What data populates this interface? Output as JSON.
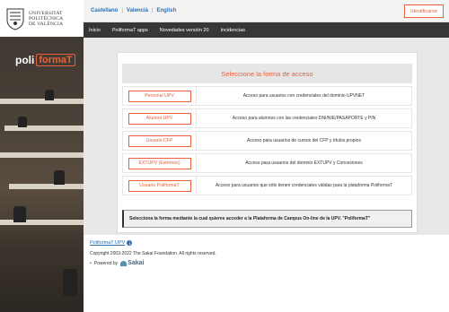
{
  "sidebar": {
    "university_lines": [
      "UNIVERSITAT",
      "POLITÈCNICA",
      "DE VALÈNCIA"
    ],
    "brand_prefix": "poli",
    "brand_name": "formaT"
  },
  "topbar": {
    "languages": [
      {
        "label": "Castellano"
      },
      {
        "label": "Valencià"
      },
      {
        "label": "English"
      }
    ],
    "separator": "|",
    "login_label": "Identificarse"
  },
  "nav": {
    "items": [
      {
        "label": "Inicio"
      },
      {
        "label": "PoliformaT apps"
      },
      {
        "label": "Novedades versión 20"
      },
      {
        "label": "Incidencias"
      }
    ]
  },
  "access": {
    "title": "Seleccione la forma de acceso",
    "options": [
      {
        "button": "Personal UPV",
        "description": "Acceso para usuarios con credenciales del dominio UPVNET"
      },
      {
        "button": "Alumno UPV",
        "description": "Acceso para alumnos con las credenciales DNI/NIE/PASAPORTE y PIN"
      },
      {
        "button": "Usuario CFP",
        "description": "Acceso para usuarios de cursos del CFP y títulos propios"
      },
      {
        "button": "EXTUPV (Externos)",
        "description": "Acceso para usuarios del dominio EXTUPV y Concesiones"
      },
      {
        "button": "Usuario PoliformaT",
        "description": "Acceso para usuarios que sólo tienen credenciales válidas para la plataforma PoliformaT"
      }
    ],
    "notice": "Selecciona la forma mediante la cual quieres acceder a la Plataforma de Campus On-line de la UPV. \"PoliformaT\""
  },
  "footer": {
    "link_label": "PoliformaT UPV",
    "info_icon": "info-icon",
    "copyright": "Copyright 2003-2022 The Sakai Foundation. All rights reserved.",
    "bullet": "•",
    "powered_by": "Powered by",
    "sakai": "Sakai"
  },
  "colors": {
    "accent": "#e8613a",
    "link": "#2a6fb5",
    "nav_bg": "#373737"
  }
}
